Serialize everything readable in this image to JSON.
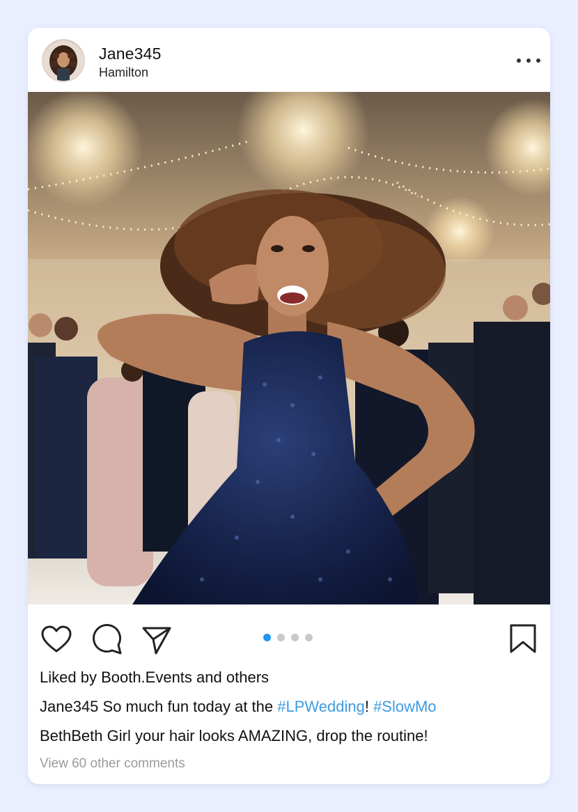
{
  "post": {
    "username": "Jane345",
    "location": "Hamilton"
  },
  "photo": {
    "description_icon": "party-photo"
  },
  "carousel": {
    "count": 4,
    "active_index": 0,
    "active_color": "#2196f3"
  },
  "likes": {
    "prefix": "Liked by ",
    "user": "Booth.Events",
    "middle": " and ",
    "suffix": "others"
  },
  "caption": {
    "user": "Jane345",
    "text": " So much fun today at the ",
    "tag1": "#LPWedding",
    "sep": "! ",
    "tag2": "#SlowMo",
    "hashtag_color": "#3d9be0"
  },
  "comment": {
    "user": "BethBeth",
    "text": " Girl your hair looks AMAZING, drop the routine!"
  },
  "view_comments": "View 60 other comments",
  "icons": {
    "like": "heart-icon",
    "comment": "comment-bubble-icon",
    "share": "send-icon",
    "save": "bookmark-icon",
    "more": "more-options-icon"
  }
}
